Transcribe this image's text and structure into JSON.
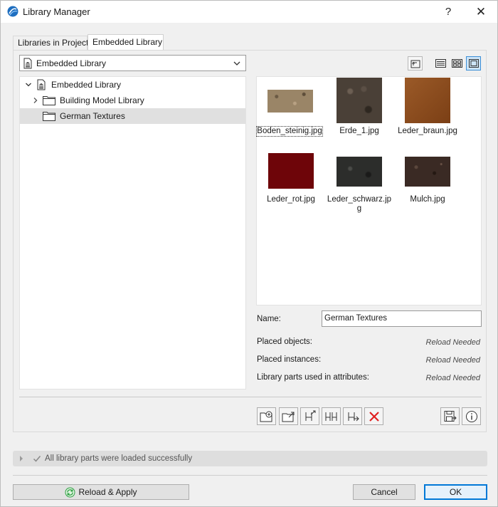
{
  "window": {
    "title": "Library Manager",
    "help_label": "?",
    "close_label": "✕"
  },
  "tabs": [
    {
      "label": "Libraries in Project",
      "active": false
    },
    {
      "label": "Embedded Library",
      "active": true
    }
  ],
  "library_select": {
    "value": "Embedded Library"
  },
  "tree": {
    "items": [
      {
        "label": "Embedded Library",
        "icon": "library-building-icon",
        "expanded": true
      },
      {
        "label": "Building Model Library",
        "icon": "folder-icon",
        "expanded": false
      },
      {
        "label": "German Textures",
        "icon": "folder-icon",
        "selected": true
      }
    ]
  },
  "thumbnails": [
    {
      "caption": "Boden_steinig.jpg",
      "color": "#9a8567",
      "selected": true
    },
    {
      "caption": "Erde_1.jpg",
      "color": "#4a4037"
    },
    {
      "caption": "Leder_braun.jpg",
      "color": "#8b4a1c"
    },
    {
      "caption": "Leder_rot.jpg",
      "color": "#6e0509"
    },
    {
      "caption": "Leder_schwarz.jpg",
      "color": "#2c2d2b"
    },
    {
      "caption": "Mulch.jpg",
      "color": "#3a2a24"
    }
  ],
  "properties": {
    "name_label": "Name:",
    "name_value": "German Textures",
    "placed_objects_label": "Placed objects:",
    "placed_objects_value": "Reload Needed",
    "placed_instances_label": "Placed instances:",
    "placed_instances_value": "Reload Needed",
    "parts_in_attributes_label": "Library parts used in attributes:",
    "parts_in_attributes_value": "Reload Needed"
  },
  "status": {
    "text": "All library parts were loaded successfully"
  },
  "buttons": {
    "reload_apply": "Reload & Apply",
    "cancel": "Cancel",
    "ok": "OK"
  },
  "colors": {
    "accent": "#0078d7",
    "delete": "#e02020",
    "reload_icon": "#2ea043"
  }
}
